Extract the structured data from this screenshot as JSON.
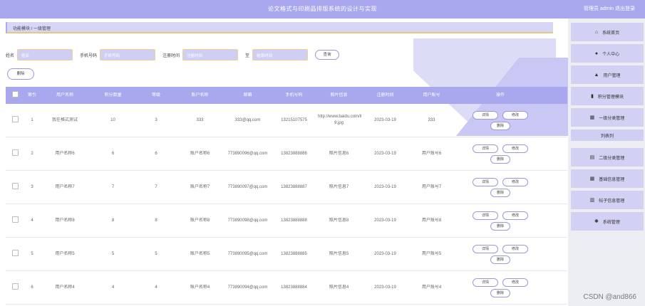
{
  "header": {
    "title": "论文格式与印刷品排版系统的设计与实现",
    "user": "管理员 admin 退出登录"
  },
  "breadcrumb": "功能模块 / 一级管理",
  "filters": {
    "f1_label": "姓名",
    "f1_placeholder": "姓名",
    "f2_label": "手机号码",
    "f2_placeholder": "手机号码",
    "f3_label": "注册时间",
    "f3_placeholder": "注册时间",
    "range_sep": "至",
    "f4_placeholder": "结束时间",
    "search_label": "查询"
  },
  "delete_label": "删除",
  "table": {
    "headers": [
      "索引",
      "用户名称",
      "积分数量",
      "等级",
      "账户名称",
      "邮箱",
      "手机号码",
      "照片信息",
      "注册时间",
      "用户账号",
      "操作"
    ],
    "rows": [
      {
        "idx": "1",
        "name": "我在格式测试",
        "points": "10",
        "level": "3",
        "account": "333",
        "email": "333@qq.com",
        "phone": "13215107575",
        "photo": "http://www.baidu.com/item=20036969 9.jpg",
        "date": "2023-03-19",
        "user": "333"
      },
      {
        "idx": "2",
        "name": "用户名称6",
        "points": "6",
        "level": "6",
        "account": "账户名称6",
        "email": "773890096@qq.com",
        "phone": "13823888886",
        "photo": "照片信息6",
        "date": "2023-03-19",
        "user": "用户账号6"
      },
      {
        "idx": "3",
        "name": "用户名称7",
        "points": "7",
        "level": "7",
        "account": "账户名称7",
        "email": "773890097@qq.com",
        "phone": "13823888887",
        "photo": "照片信息7",
        "date": "2023-03-19",
        "user": "用户账号7"
      },
      {
        "idx": "4",
        "name": "用户名称8",
        "points": "8",
        "level": "8",
        "account": "账户名称8",
        "email": "773890098@qq.com",
        "phone": "13823888888",
        "photo": "照片信息8",
        "date": "2023-03-19",
        "user": "用户账号8"
      },
      {
        "idx": "5",
        "name": "用户名称5",
        "points": "5",
        "level": "5",
        "account": "账户名称5",
        "email": "773890095@qq.com",
        "phone": "13823888885",
        "photo": "照片信息5",
        "date": "2023-03-19",
        "user": "用户账号5"
      },
      {
        "idx": "6",
        "name": "用户名称4",
        "points": "4",
        "level": "4",
        "account": "账户名称4",
        "email": "773890094@qq.com",
        "phone": "13823888884",
        "photo": "照片信息4",
        "date": "2023-03-19",
        "user": "用户账号4"
      }
    ],
    "op_detail": "详情",
    "op_edit": "修改",
    "op_delete": "删除"
  },
  "sidebar": {
    "items": [
      {
        "icon": "home-icon",
        "label": "系统首页"
      },
      {
        "icon": "user-icon",
        "label": "个人中心"
      },
      {
        "icon": "lock-icon",
        "label": "用户管理"
      },
      {
        "icon": "chart-icon",
        "label": "积分管理模块"
      },
      {
        "icon": "grid-icon",
        "label": "一级分类管理"
      },
      {
        "icon": "doc-icon",
        "label": "二级分类管理"
      },
      {
        "icon": "grid-icon",
        "label": "基础信息管理"
      },
      {
        "icon": "list-icon",
        "label": "帖子信息管理"
      },
      {
        "icon": "gear-icon",
        "label": "系统管理"
      }
    ],
    "sub_label": "列表列"
  },
  "watermark": "CSDN @and866",
  "colors": {
    "primary": "#a9a8ee",
    "sidebar_bg": "#ededf4",
    "accent_border": "#e8c87c"
  }
}
